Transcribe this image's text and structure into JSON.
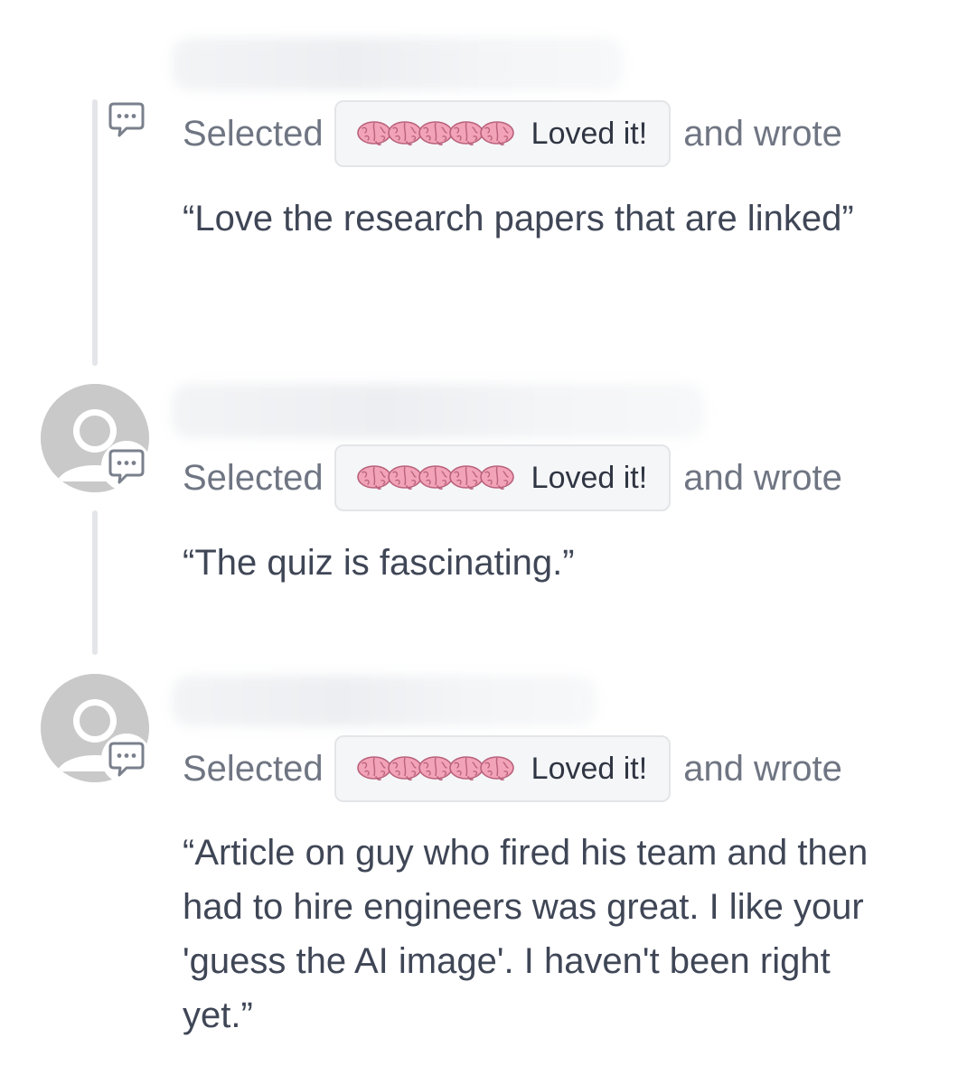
{
  "feedback": {
    "items": [
      {
        "selected_label": "Selected",
        "rating_label": "Loved it!",
        "wrote_label": "and wrote",
        "comment": "“Love the research papers that are linked”"
      },
      {
        "selected_label": "Selected",
        "rating_label": "Loved it!",
        "wrote_label": "and wrote",
        "comment": "“The quiz is fascinating.”"
      },
      {
        "selected_label": "Selected",
        "rating_label": "Loved it!",
        "wrote_label": "and wrote",
        "comment": "“Article on guy who fired his team and then had to hire engineers was great. I like your 'guess the AI image'. I haven't been right yet.”"
      }
    ],
    "rating_icon": "brain-icon",
    "rating_count": 5
  },
  "colors": {
    "brain_pink": "#f2a3b8",
    "chip_background": "#f5f6f8",
    "avatar_gray": "#c9c9c9",
    "muted_text": "#6f7582",
    "body_text": "#3f4656"
  }
}
